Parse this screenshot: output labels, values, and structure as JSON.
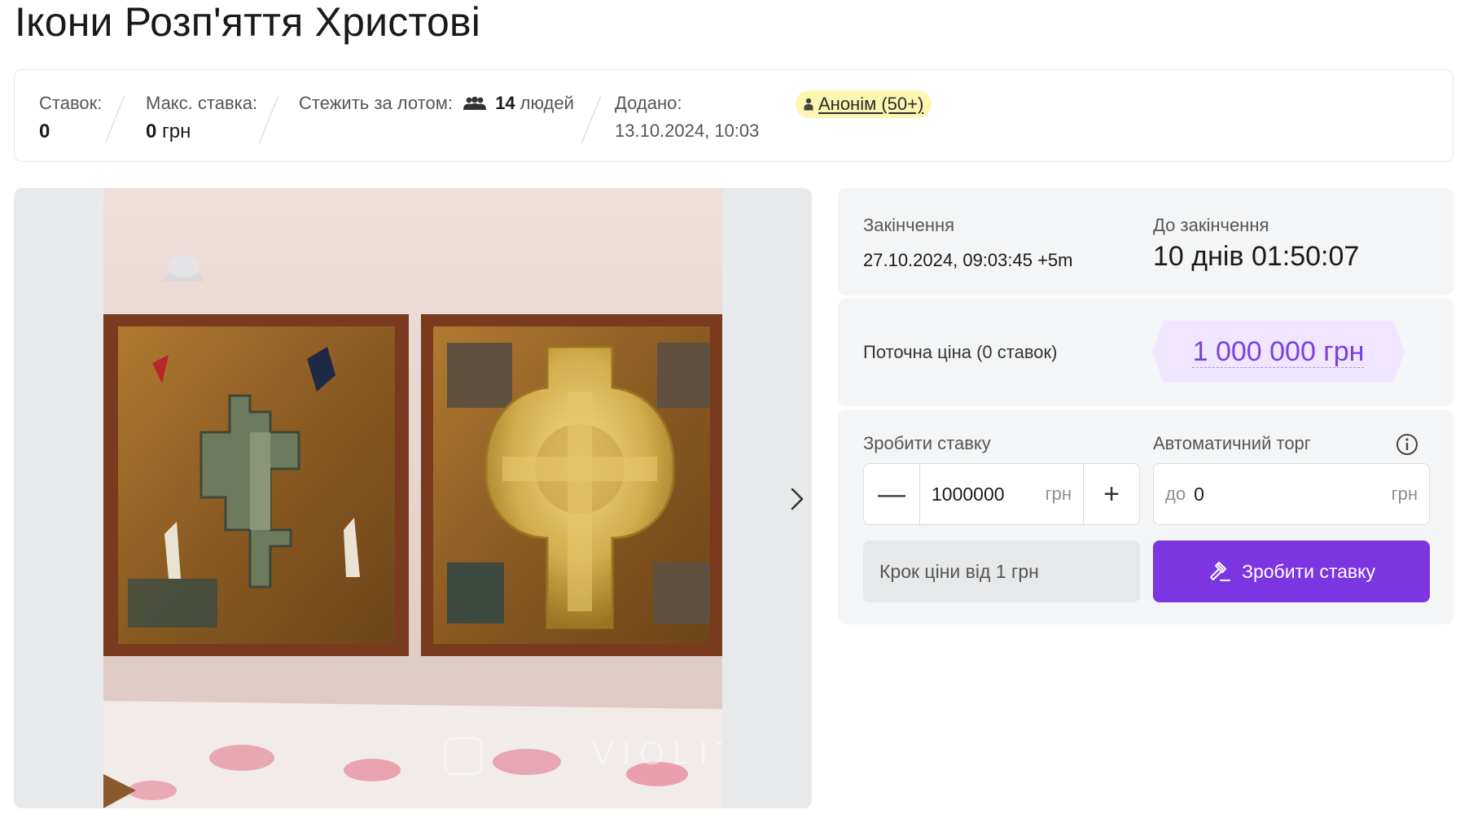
{
  "title": "Ікони Розп'яття Христові",
  "stats": {
    "bids_label": "Ставок:",
    "bids_value": "0",
    "max_bid_label": "Макс. ставка:",
    "max_bid_value": "0",
    "max_bid_currency": "грн",
    "watchers_label": "Стежить за лотом:",
    "watchers_count": "14",
    "watchers_unit": "людей",
    "added_label": "Додано:",
    "added_value": "13.10.2024, 10:03",
    "seller_name": "Анонім (50+)"
  },
  "gallery": {
    "watermark": "VIOLITY"
  },
  "timing": {
    "end_label": "Закінчення",
    "end_value": "27.10.2024, 09:03:45 +5m",
    "remaining_label": "До закінчення",
    "remaining_value": "10 днів 01:50:07"
  },
  "price": {
    "label": "Поточна ціна (0 ставок)",
    "value": "1 000 000 грн"
  },
  "bid": {
    "label": "Зробити ставку",
    "minus": "—",
    "plus": "+",
    "amount": "1000000",
    "currency": "грн",
    "step_text": "Крок ціни від 1 грн",
    "auto_label": "Автоматичний торг",
    "auto_prefix": "до",
    "auto_value": "0",
    "auto_currency": "грн",
    "button_label": "Зробити ставку"
  },
  "colors": {
    "accent": "#7b36e2",
    "price_bg": "#f0e6ff",
    "seller_badge": "#fbf6b0"
  }
}
